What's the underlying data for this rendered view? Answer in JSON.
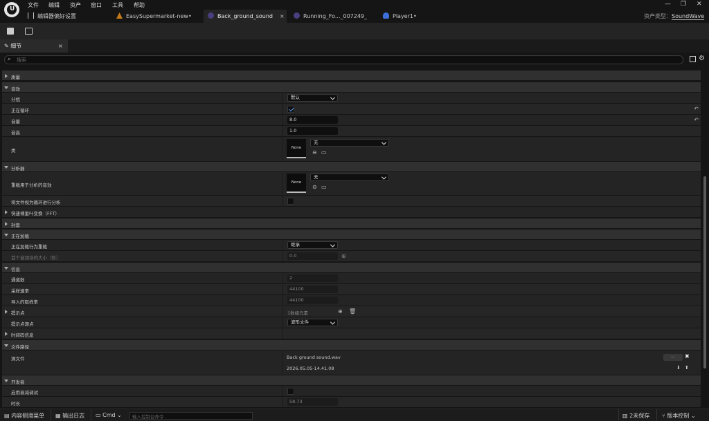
{
  "menu": [
    "文件",
    "编辑",
    "资产",
    "窗口",
    "工具",
    "帮助"
  ],
  "tabs": [
    {
      "label": "编辑器偏好设置",
      "icon": "settings-sliders-icon"
    },
    {
      "label": "EasySupermarket-new•",
      "icon": "level-icon"
    },
    {
      "label": "Back_ground_sound",
      "icon": "soundwave-asset-icon",
      "close": "×"
    },
    {
      "label": "Running_Fo..._007249_",
      "icon": "soundwave-asset-icon"
    },
    {
      "label": "Player1•",
      "icon": "player-icon"
    }
  ],
  "asset_type": {
    "label": "资产类型：",
    "value": "SoundWave"
  },
  "details_tab": {
    "label": "细节",
    "close": "×"
  },
  "search_placeholder": "搜索",
  "sections": {
    "quality": "质量",
    "sound": "音效",
    "analysis": "分析器",
    "fft": "快速傅里叶变换（FFT）",
    "envelope": "封套",
    "loading": "正在加载",
    "info": "信息",
    "cue_points": "提示点",
    "timecode": "时间码信息",
    "file_path": "文件路径",
    "developer": "开发者"
  },
  "props": {
    "group": {
      "label": "分组",
      "value": "默认"
    },
    "looping": {
      "label": "正在循环",
      "checked": true
    },
    "volume": {
      "label": "音量",
      "value": "8.0"
    },
    "pitch": {
      "label": "音高",
      "value": "1.0"
    },
    "class": {
      "label": "类",
      "value": "无",
      "thumb": "None"
    },
    "analysis_override": {
      "label": "重载用于分析的音效",
      "value": "无",
      "thumb": "None"
    },
    "treat_loop": {
      "label": "将文件视为循环进行分析",
      "checked": false
    },
    "loading_override": {
      "label": "正在加载行为重载",
      "value": "继承"
    },
    "chunk_size": {
      "label": "首个音频块的大小（秒）",
      "value": "0.0"
    },
    "channels": {
      "label": "通道数",
      "value": "2"
    },
    "sample_rate": {
      "label": "采样速率",
      "value": "44100"
    },
    "import_rate": {
      "label": "导入的取样率",
      "value": "44100"
    },
    "cue_points": {
      "label": "提示点",
      "value": "1数组元素"
    },
    "cue_source": {
      "label": "提示点源点",
      "value": "波形文件"
    },
    "source_file": {
      "label": "源文件",
      "value": "Back ground sound.wav",
      "date": "2026.05.05-14.41.08",
      "browse": "...",
      "clear": "✖"
    },
    "attenuation_debug": {
      "label": "启用衰减调试",
      "checked": false
    },
    "duration": {
      "label": "时长",
      "value": "58.73"
    }
  },
  "statusbar": {
    "content_drawer": "内容侧滑菜单",
    "output_log": "输出日志",
    "cmd": "Cmd",
    "console_placeholder": "输入控制台命令",
    "unsaved": "2未保存",
    "source_control": "版本控制"
  },
  "colors": {
    "accent": "#5aa0ff",
    "bg": "#151515",
    "panel": "#242424",
    "category": "#303030"
  }
}
